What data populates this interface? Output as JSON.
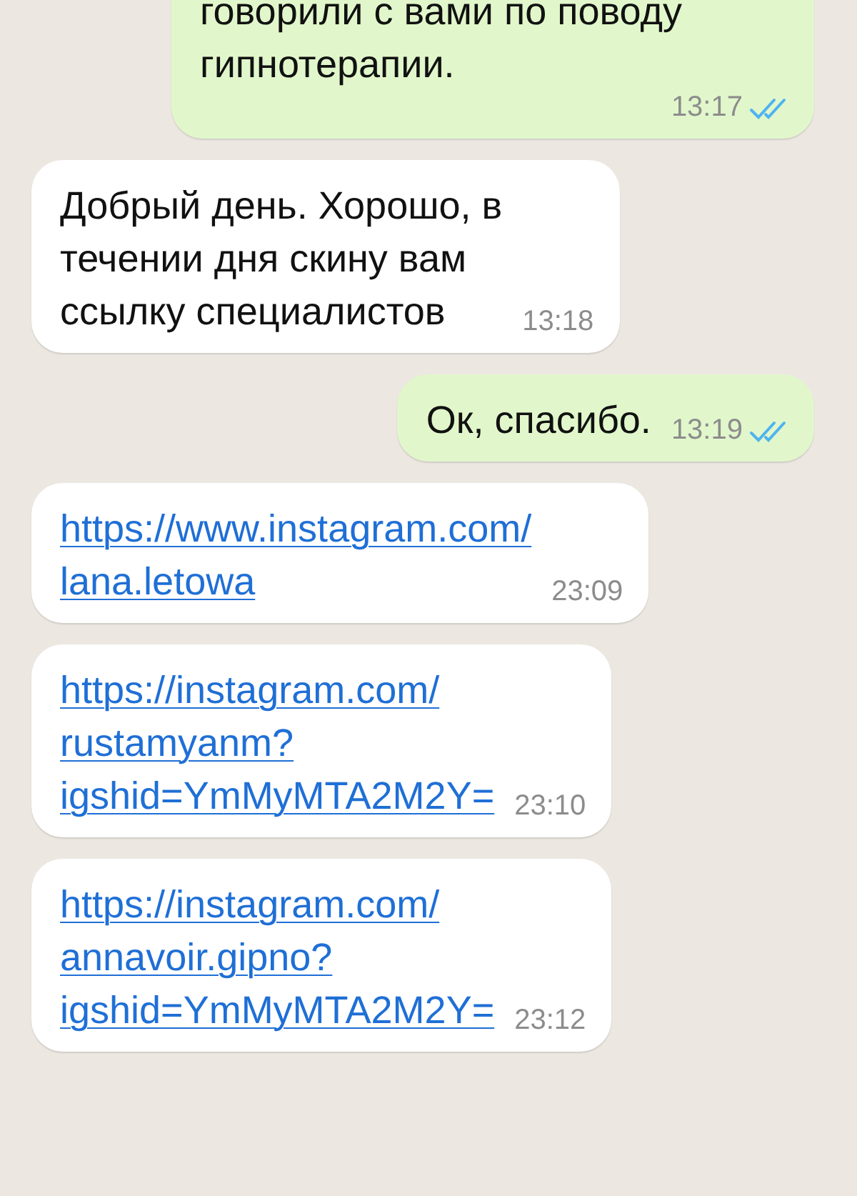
{
  "messages": [
    {
      "kind": "outgoing",
      "lines": [
        "говорили с вами по поводу",
        "гипнотерапии."
      ],
      "time": "13:17",
      "read": true
    },
    {
      "kind": "incoming",
      "lines": [
        "Добрый день. Хорошо, в",
        "течении дня скину вам",
        "ссылку специалистов"
      ],
      "time": "13:18"
    },
    {
      "kind": "outgoing",
      "lines": [
        "Ок, спасибо."
      ],
      "time": "13:19",
      "read": true
    },
    {
      "kind": "incoming",
      "link": true,
      "lines": [
        "https://www.instagram.com/",
        "lana.letowa"
      ],
      "time": "23:09"
    },
    {
      "kind": "incoming",
      "link": true,
      "lines": [
        "https://instagram.com/",
        "rustamyanm?",
        "igshid=YmMyMTA2M2Y="
      ],
      "time": "23:10"
    },
    {
      "kind": "incoming",
      "link": true,
      "lines": [
        "https://instagram.com/",
        "annavoir.gipno?",
        "igshid=YmMyMTA2M2Y="
      ],
      "time": "23:12"
    }
  ]
}
